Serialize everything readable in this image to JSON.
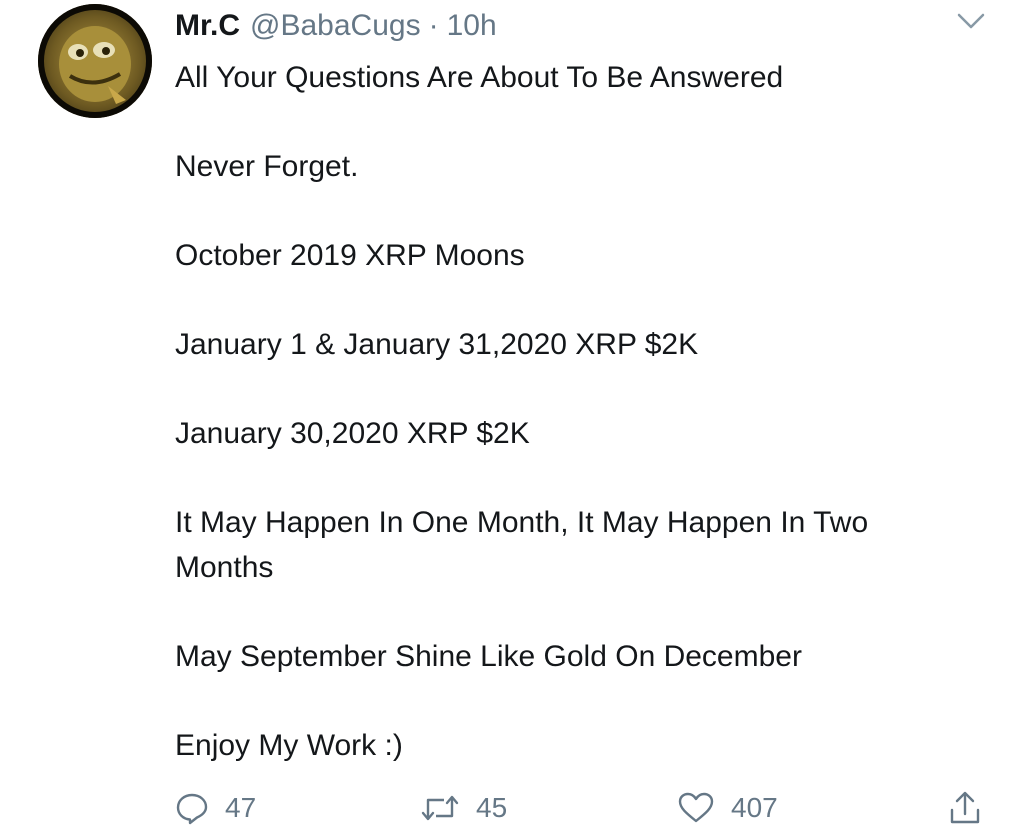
{
  "tweet": {
    "author_name": "Mr.C",
    "handle": "@BabaCugs",
    "separator": "·",
    "time": "10h",
    "paragraphs": [
      "All Your Questions Are About To Be Answered",
      "Never Forget.",
      "October 2019 XRP Moons",
      "January 1 & January 31,2020 XRP $2K",
      "January 30,2020 XRP $2K",
      "It May Happen In One Month, It May Happen In Two Months",
      "May September Shine Like Gold On December",
      "Enjoy My Work :)"
    ],
    "actions": {
      "reply_count": "47",
      "retweet_count": "45",
      "like_count": "407"
    }
  },
  "icons": {
    "avatar": "avatar-image",
    "caret": "chevron-down-icon",
    "reply": "reply-icon",
    "retweet": "retweet-icon",
    "like": "heart-icon",
    "share": "share-icon"
  },
  "colors": {
    "text": "#14171a",
    "secondary": "#657786",
    "background": "#ffffff"
  }
}
